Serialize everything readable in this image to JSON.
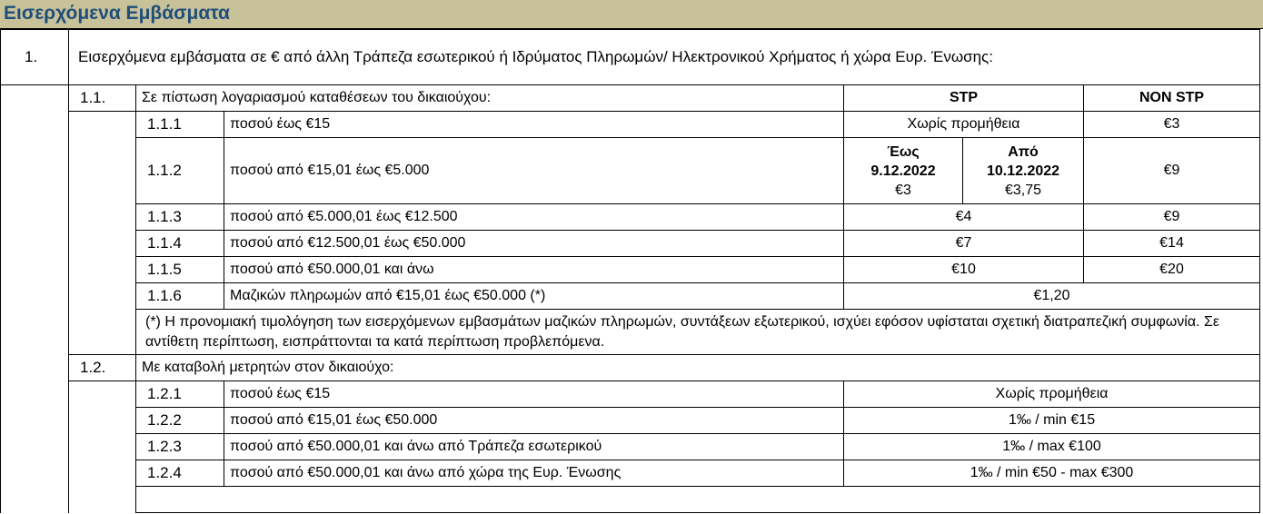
{
  "header": {
    "title": "Εισερχόμενα Εμβάσματα"
  },
  "section1": {
    "num": "1.",
    "text": "Εισερχόμενα εμβάσματα σε € από άλλη Τράπεζα εσωτερικού ή Ιδρύματος Πληρωμών/ Ηλεκτρονικού Χρήματος ή χώρα Ευρ. Ένωσης:"
  },
  "sub11": {
    "num": "1.1.",
    "text": "Σε πίστωση λογαριασμού καταθέσεων του δικαιούχου:",
    "stp": "STP",
    "nonstp": "NON STP"
  },
  "rows11": {
    "r1": {
      "num": "1.1.1",
      "desc": "ποσού  έως   €15",
      "stp": "Χωρίς προμήθεια",
      "nonstp": "€3"
    },
    "r2": {
      "num": "1.1.2",
      "desc": "ποσού  από  €15,01  έως  €5.000",
      "until_label": "Έως",
      "until_date": "9.12.2022",
      "until_value": "€3",
      "from_label": "Από",
      "from_date": "10.12.2022",
      "from_value": "€3,75",
      "nonstp": "€9"
    },
    "r3": {
      "num": "1.1.3",
      "desc": "ποσού  από  €5.000,01  έως  €12.500",
      "stp": "€4",
      "nonstp": "€9"
    },
    "r4": {
      "num": "1.1.4",
      "desc": "ποσού  από  €12.500,01  έως  €50.000",
      "stp": "€7",
      "nonstp": "€14"
    },
    "r5": {
      "num": "1.1.5",
      "desc": "ποσού  από  €50.000,01 και άνω",
      "stp": "€10",
      "nonstp": "€20"
    },
    "r6": {
      "num": "1.1.6",
      "desc": "Μαζικών πληρωμών από €15,01  έως  €50.000  (*)",
      "value": "€1,20"
    }
  },
  "note": "(*) Η προνομιακή τιμολόγηση των εισερχόμενων εμβασμάτων μαζικών πληρωμών, συντάξεων  εξωτερικού, ισχύει εφόσον υφίσταται σχετική διατραπεζική συμφωνία. Σε αντίθετη περίπτωση, εισπράττονται τα κατά περίπτωση προβλεπόμενα.",
  "sub12": {
    "num": "1.2.",
    "text": "Με καταβολή μετρητών στον δικαιούχο:"
  },
  "rows12": {
    "r1": {
      "num": "1.2.1",
      "desc": "ποσού  έως   €15",
      "value": "Χωρίς προμήθεια"
    },
    "r2": {
      "num": "1.2.2",
      "desc": "ποσού  από  €15,01  έως  €50.000",
      "value": "1‰ / min €15"
    },
    "r3": {
      "num": "1.2.3",
      "desc": "ποσού  από  €50.000,01  και  άνω από  Τράπεζα  εσωτερικού",
      "value": "1‰ / max €100"
    },
    "r4": {
      "num": "1.2.4",
      "desc": "ποσού  από  €50.000,01  και  άνω από  χώρα  της  Ευρ.  Ένωσης",
      "value": "1‰ / min €50 - max €300"
    }
  }
}
